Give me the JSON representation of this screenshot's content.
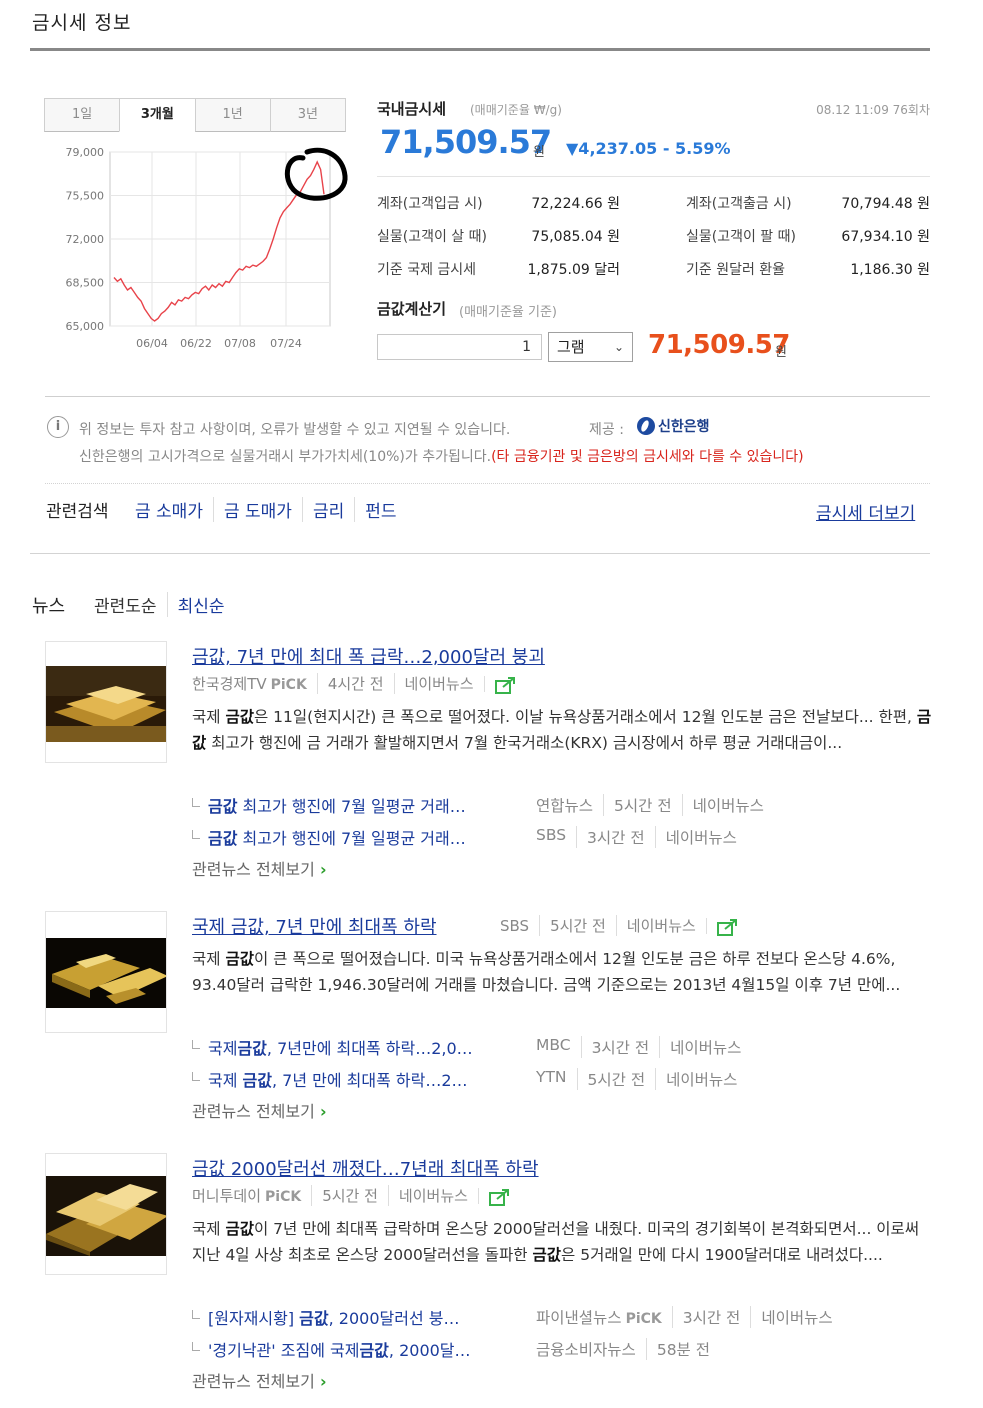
{
  "page_title": "금시세 정보",
  "period_tabs": [
    "1일",
    "3개월",
    "1년",
    "3년"
  ],
  "active_tab": "3개월",
  "chart_data": {
    "type": "line",
    "x_tick_labels": [
      "06/04",
      "06/22",
      "07/08",
      "07/24"
    ],
    "y_tick_labels": [
      "79,000",
      "75,500",
      "72,000",
      "68,500",
      "65,000"
    ],
    "ylim": [
      65000,
      79000
    ],
    "grid": true,
    "series": [
      {
        "color": "#e8434a",
        "values": [
          68900,
          68600,
          68800,
          68300,
          67900,
          68100,
          67700,
          67300,
          67000,
          66400,
          66000,
          65600,
          65400,
          65600,
          66000,
          66200,
          66500,
          66900,
          66700,
          67100,
          67000,
          67300,
          67200,
          67500,
          67700,
          67600,
          68000,
          68200,
          67900,
          68300,
          68100,
          68400,
          68200,
          68600,
          68500,
          68900,
          69300,
          69600,
          69500,
          69800,
          69700,
          69900,
          69800,
          70000,
          70200,
          70500,
          71200,
          72000,
          72900,
          73700,
          74200,
          74500,
          74800,
          75200,
          75600,
          75800,
          76300,
          76800,
          77100,
          77600,
          78200,
          77600,
          75600
        ]
      }
    ],
    "annotation": "hand-drawn black circle around recent peak"
  },
  "domestic": {
    "title": "국내금시세",
    "subtitle": "(매매기준율 ₩/g)",
    "timestamp": "08.12 11:09 76회차",
    "price": "71,509.57",
    "price_unit": "원",
    "change": "▼4,237.05 - 5.59%",
    "rows": [
      {
        "l1": "계좌(고객입금 시)",
        "v1": "72,224.66 원",
        "l2": "계좌(고객출금 시)",
        "v2": "70,794.48 원"
      },
      {
        "l1": "실물(고객이 살 때)",
        "v1": "75,085.04 원",
        "l2": "실물(고객이 팔 때)",
        "v2": "67,934.10 원"
      },
      {
        "l1": "기준 국제 금시세",
        "v1": "1,875.09 달러",
        "l2": "기준 원달러 환율",
        "v2": "1,186.30 원"
      }
    ]
  },
  "calculator": {
    "title": "금값계산기",
    "subtitle": "(매매기준율 기준)",
    "quantity": "1",
    "unit": "그램",
    "result": "71,509.57",
    "result_unit": "원"
  },
  "notice": {
    "line1": "위 정보는 투자 참고 사항이며, 오류가 발생할 수 있고 지연될 수 있습니다.",
    "provider_label": "제공 :",
    "provider": "신한은행",
    "line2": "신한은행의 고시가격으로 실물거래시 부가가치세(10%)가 추가됩니다.",
    "warning": "(타 금융기관 및 금은방의 금시세와 다를 수 있습니다)"
  },
  "related": {
    "label": "관련검색",
    "links": [
      "금 소매가",
      "금 도매가",
      "금리",
      "펀드"
    ],
    "more": "금시세 더보기"
  },
  "news": {
    "label": "뉴스",
    "sort": [
      "관련도순",
      "최신순"
    ],
    "pick": "PiCK",
    "all_label": "관련뉴스 전체보기",
    "items": [
      {
        "title": "금값, 7년 만에 최대 폭 급락…2,000달러 붕괴",
        "source": "한국경제TV",
        "time": "4시간 전",
        "portal": "네이버뉴스",
        "desc": [
          [
            "국제 ",
            ""
          ],
          [
            "금값",
            "b"
          ],
          [
            "은 11일(현지시간) 큰 폭으로 떨어졌다. 이날 뉴욕상품거래소에서 12월 인도분 금은 전날보다... 한편, ",
            ""
          ],
          [
            "금값",
            "b"
          ],
          [
            " 최고가 행진에 금 거래가 활발해지면서 7월 한국거래소(KRX) 금시장에서 하루 평균 거래대금이...",
            ""
          ]
        ],
        "related": [
          {
            "pre": "",
            "bold": "금값",
            "post": " 최고가 행진에 7월 일평균 거래…",
            "meta": [
              "연합뉴스",
              "5시간 전",
              "네이버뉴스"
            ]
          },
          {
            "pre": "",
            "bold": "금값",
            "post": " 최고가 행진에 7월 일평균 거래…",
            "meta": [
              "SBS",
              "3시간 전",
              "네이버뉴스"
            ]
          }
        ]
      },
      {
        "title": "국제 금값, 7년 만에 최대폭 하락",
        "source": "SBS",
        "time": "5시간 전",
        "portal": "네이버뉴스",
        "desc": [
          [
            "국제 ",
            ""
          ],
          [
            "금값",
            "b"
          ],
          [
            "이 큰 폭으로 떨어졌습니다. 미국 뉴욕상품거래소에서 12월 인도분 금은 하루 전보다 온스당 4.6%, 93.40달러 급락한 1,946.30달러에 거래를 마쳤습니다. 금액 기준으로는 2013년 4월15일 이후 7년 만에...",
            ""
          ]
        ],
        "related": [
          {
            "pre": "국제",
            "bold": "금값",
            "post": ", 7년만에 최대폭 하락…2,0…",
            "meta": [
              "MBC",
              "3시간 전",
              "네이버뉴스"
            ]
          },
          {
            "pre": "국제 ",
            "bold": "금값",
            "post": ", 7년 만에 최대폭 하락…2…",
            "meta": [
              "YTN",
              "5시간 전",
              "네이버뉴스"
            ]
          }
        ]
      },
      {
        "title": "금값 2000달러선 깨졌다…7년래 최대폭 하락",
        "source": "머니투데이",
        "time": "5시간 전",
        "portal": "네이버뉴스",
        "desc": [
          [
            "국제 ",
            ""
          ],
          [
            "금값",
            "b"
          ],
          [
            "이 7년 만에 최대폭 급락하며 온스당 2000달러선을 내줬다. 미국의 경기회복이 본격화되면서... 이로써 지난 4일 사상 최초로 온스당 2000달러선을 돌파한 ",
            ""
          ],
          [
            "금값",
            "b"
          ],
          [
            "은 5거래일 만에 다시 1900달러대로 내려섰다....",
            ""
          ]
        ],
        "related": [
          {
            "pre": "[원자재시황] ",
            "bold": "금값",
            "post": ", 2000달러선 붕…",
            "meta": [
              "파이낸셜뉴스",
              "3시간 전",
              "네이버뉴스"
            ],
            "pick": true
          },
          {
            "pre": "'경기낙관' 조짐에 국제",
            "bold": "금값",
            "post": ", 2000달…",
            "meta": [
              "금융소비자뉴스",
              "58분 전"
            ]
          }
        ]
      }
    ]
  }
}
